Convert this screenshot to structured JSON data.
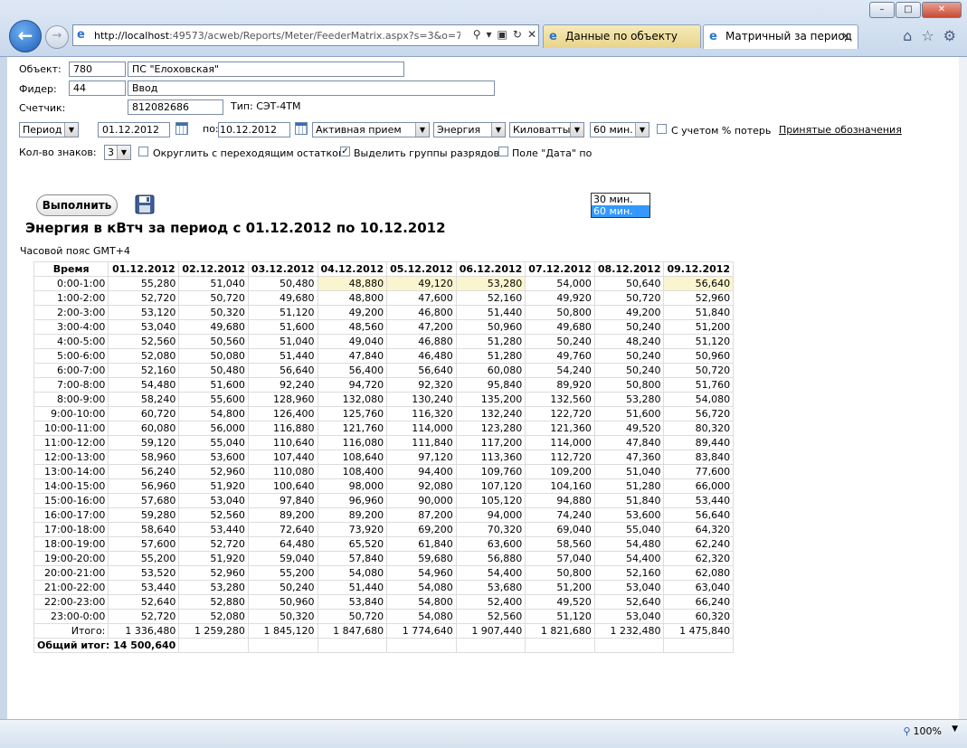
{
  "browser": {
    "url_host": "http://localhost",
    "url_rest": ":49573/acweb/Reports/Meter/FeederMatrix.aspx?s=3&o=780",
    "tabs": [
      {
        "label": "Данные по объекту"
      },
      {
        "label": "Матричный за период"
      }
    ],
    "zoom": "100%"
  },
  "form": {
    "object_label": "Объект:",
    "object_code": "780",
    "object_name": "ПС \"Елоховская\"",
    "feeder_label": "Фидер:",
    "feeder_code": "44",
    "feeder_name": "Ввод",
    "meter_label": "Счетчик:",
    "meter_number": "812082686",
    "meter_type": "Тип: СЭТ-4ТМ",
    "period_select": "Период",
    "date_from": "01.12.2012",
    "to_label": "по:",
    "date_to": "10.12.2012",
    "energy_kind": "Активная прием",
    "measure": "Энергия",
    "unit": "Киловатты",
    "interval": "60 мин.",
    "interval_options": [
      "30 мин.",
      "60 мин."
    ],
    "losses_label": "С учетом % потерь",
    "legend_link": "Принятые обозначения",
    "digits_label": "Кол-во знаков:",
    "digits_value": "3",
    "round_label": "Округлить с переходящим остатком",
    "group_label": "Выделить группы разрядов",
    "date_field_label": "Поле \"Дата\" по"
  },
  "actions": {
    "run_label": "Выполнить"
  },
  "report": {
    "title": "Энергия в кВтч за период с 01.12.2012 по 10.12.2012",
    "timezone": "Часовой пояс GMT+4",
    "time_header": "Время",
    "dates": [
      "01.12.2012",
      "02.12.2012",
      "03.12.2012",
      "04.12.2012",
      "05.12.2012",
      "06.12.2012",
      "07.12.2012",
      "08.12.2012",
      "09.12.2012"
    ],
    "rows": [
      {
        "time": "0:00-1:00",
        "v": [
          "55,280",
          "51,040",
          "50,480",
          "48,880",
          "49,120",
          "53,280",
          "54,000",
          "50,640",
          "56,640"
        ],
        "hl": [
          3,
          4,
          5,
          8
        ]
      },
      {
        "time": "1:00-2:00",
        "v": [
          "52,720",
          "50,720",
          "49,680",
          "48,800",
          "47,600",
          "52,160",
          "49,920",
          "50,720",
          "52,960"
        ]
      },
      {
        "time": "2:00-3:00",
        "v": [
          "53,120",
          "50,320",
          "51,120",
          "49,200",
          "46,800",
          "51,440",
          "50,800",
          "49,200",
          "51,840"
        ]
      },
      {
        "time": "3:00-4:00",
        "v": [
          "53,040",
          "49,680",
          "51,600",
          "48,560",
          "47,200",
          "50,960",
          "49,680",
          "50,240",
          "51,200"
        ]
      },
      {
        "time": "4:00-5:00",
        "v": [
          "52,560",
          "50,560",
          "51,040",
          "49,040",
          "46,880",
          "51,280",
          "50,240",
          "48,240",
          "51,120"
        ]
      },
      {
        "time": "5:00-6:00",
        "v": [
          "52,080",
          "50,080",
          "51,440",
          "47,840",
          "46,480",
          "51,280",
          "49,760",
          "50,240",
          "50,960"
        ]
      },
      {
        "time": "6:00-7:00",
        "v": [
          "52,160",
          "50,480",
          "56,640",
          "56,400",
          "56,640",
          "60,080",
          "54,240",
          "50,240",
          "50,720"
        ]
      },
      {
        "time": "7:00-8:00",
        "v": [
          "54,480",
          "51,600",
          "92,240",
          "94,720",
          "92,320",
          "95,840",
          "89,920",
          "50,800",
          "51,760"
        ]
      },
      {
        "time": "8:00-9:00",
        "v": [
          "58,240",
          "55,600",
          "128,960",
          "132,080",
          "130,240",
          "135,200",
          "132,560",
          "53,280",
          "54,080"
        ]
      },
      {
        "time": "9:00-10:00",
        "v": [
          "60,720",
          "54,800",
          "126,400",
          "125,760",
          "116,320",
          "132,240",
          "122,720",
          "51,600",
          "56,720"
        ]
      },
      {
        "time": "10:00-11:00",
        "v": [
          "60,080",
          "56,000",
          "116,880",
          "121,760",
          "114,000",
          "123,280",
          "121,360",
          "49,520",
          "80,320"
        ]
      },
      {
        "time": "11:00-12:00",
        "v": [
          "59,120",
          "55,040",
          "110,640",
          "116,080",
          "111,840",
          "117,200",
          "114,000",
          "47,840",
          "89,440"
        ]
      },
      {
        "time": "12:00-13:00",
        "v": [
          "58,960",
          "53,600",
          "107,440",
          "108,640",
          "97,120",
          "113,360",
          "112,720",
          "47,360",
          "83,840"
        ]
      },
      {
        "time": "13:00-14:00",
        "v": [
          "56,240",
          "52,960",
          "110,080",
          "108,400",
          "94,400",
          "109,760",
          "109,200",
          "51,040",
          "77,600"
        ]
      },
      {
        "time": "14:00-15:00",
        "v": [
          "56,960",
          "51,920",
          "100,640",
          "98,000",
          "92,080",
          "107,120",
          "104,160",
          "51,280",
          "66,000"
        ]
      },
      {
        "time": "15:00-16:00",
        "v": [
          "57,680",
          "53,040",
          "97,840",
          "96,960",
          "90,000",
          "105,120",
          "94,880",
          "51,840",
          "53,440"
        ]
      },
      {
        "time": "16:00-17:00",
        "v": [
          "59,280",
          "52,560",
          "89,200",
          "89,200",
          "87,200",
          "94,000",
          "74,240",
          "53,600",
          "56,640"
        ]
      },
      {
        "time": "17:00-18:00",
        "v": [
          "58,640",
          "53,440",
          "72,640",
          "73,920",
          "69,200",
          "70,320",
          "69,040",
          "55,040",
          "64,320"
        ]
      },
      {
        "time": "18:00-19:00",
        "v": [
          "57,600",
          "52,720",
          "64,480",
          "65,520",
          "61,840",
          "63,600",
          "58,560",
          "54,480",
          "62,240"
        ]
      },
      {
        "time": "19:00-20:00",
        "v": [
          "55,200",
          "51,920",
          "59,040",
          "57,840",
          "59,680",
          "56,880",
          "57,040",
          "54,400",
          "62,320"
        ]
      },
      {
        "time": "20:00-21:00",
        "v": [
          "53,520",
          "52,960",
          "55,200",
          "54,080",
          "54,960",
          "54,400",
          "50,800",
          "52,160",
          "62,080"
        ]
      },
      {
        "time": "21:00-22:00",
        "v": [
          "53,440",
          "53,280",
          "50,240",
          "51,440",
          "54,080",
          "53,680",
          "51,200",
          "53,040",
          "63,040"
        ]
      },
      {
        "time": "22:00-23:00",
        "v": [
          "52,640",
          "52,880",
          "50,960",
          "53,840",
          "54,800",
          "52,400",
          "49,520",
          "52,640",
          "66,240"
        ]
      },
      {
        "time": "23:00-0:00",
        "v": [
          "52,720",
          "52,080",
          "50,320",
          "50,720",
          "54,080",
          "52,560",
          "51,120",
          "53,040",
          "60,320"
        ]
      }
    ],
    "totals_label": "Итого:",
    "totals": [
      "1 336,480",
      "1 259,280",
      "1 845,120",
      "1 847,680",
      "1 774,640",
      "1 907,440",
      "1 821,680",
      "1 232,480",
      "1 475,840"
    ],
    "grand_total_label": "Общий итог:",
    "grand_total": "14 500,640"
  }
}
